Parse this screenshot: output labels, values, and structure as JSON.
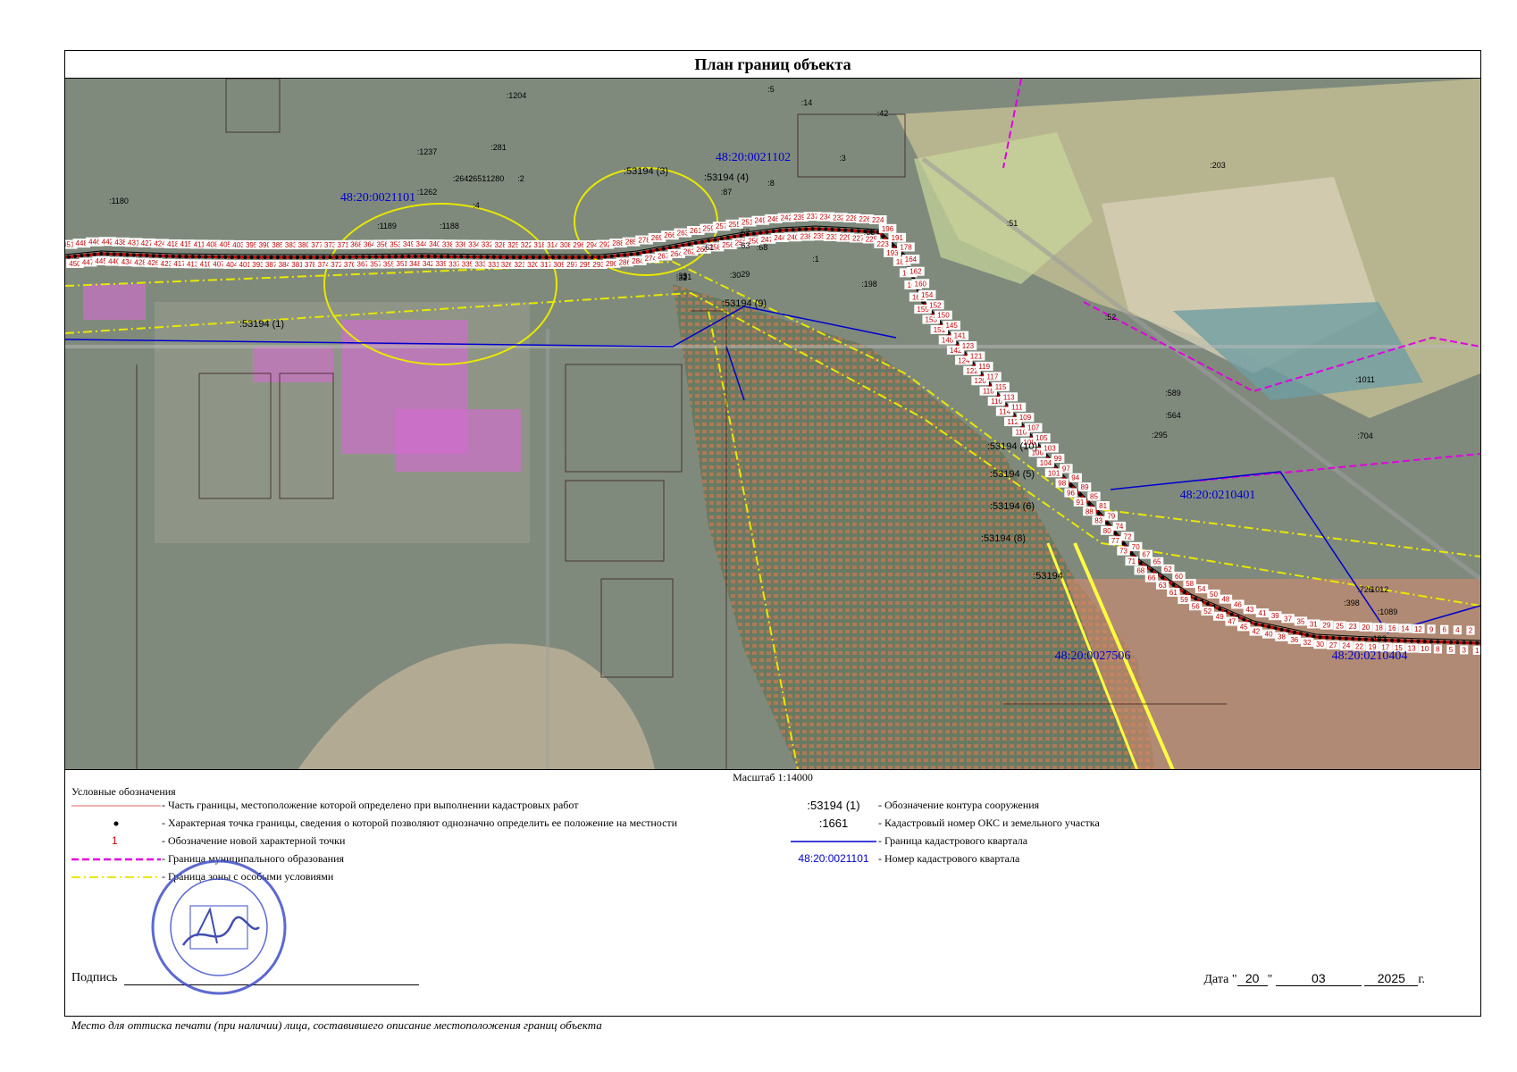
{
  "title": "План границ объекта",
  "scale_text": "Масштаб 1:14000",
  "map": {
    "quarter_labels": [
      "48:20:0021102",
      "48:20:0021101",
      "48:20:0210401",
      "48:20:0027506",
      "48:20:0210404"
    ],
    "contour_labels": [
      ":53194 (3)",
      ":53194 (4)",
      ":53194 (1)",
      ":53194 (9)",
      ":53194 (10)",
      ":53194 (5)",
      ":53194 (6)",
      ":53194 (8)",
      ":53194"
    ],
    "parcel_labels": [
      ":14",
      ":42",
      ":3",
      ":8",
      ":2",
      ":1237",
      ":1262",
      ":1280",
      ":1204",
      ":1188",
      ":1189",
      ":1180",
      ":1",
      ":88",
      ":29",
      ":30",
      ":31",
      ":32",
      ":33",
      ":198",
      ":51",
      ":52",
      ":62",
      ":63",
      ":68",
      ":87",
      ":61",
      ":704",
      ":726",
      ":1011",
      ":1012",
      ":1089",
      ":295",
      ":398",
      ":589",
      ":564",
      ":203",
      ":193",
      ":2651",
      ":2642",
      ":281",
      ":4",
      ":5"
    ],
    "point_labels": [
      "451",
      "450",
      "448",
      "447",
      "446",
      "445",
      "442",
      "440",
      "438",
      "434",
      "431",
      "428",
      "427",
      "426",
      "424",
      "423",
      "418",
      "417",
      "415",
      "413",
      "411",
      "410",
      "408",
      "407",
      "405",
      "404",
      "403",
      "401",
      "395",
      "393",
      "390",
      "387",
      "385",
      "384",
      "383",
      "381",
      "380",
      "378",
      "377",
      "374",
      "373",
      "372",
      "371",
      "370",
      "368",
      "367",
      "364",
      "357",
      "356",
      "355",
      "353",
      "351",
      "349",
      "348",
      "344",
      "342",
      "340",
      "339",
      "338",
      "337",
      "336",
      "335",
      "334",
      "333",
      "332",
      "331",
      "328",
      "326",
      "325",
      "323",
      "322",
      "320",
      "318",
      "317",
      "314",
      "309",
      "308",
      "297",
      "296",
      "295",
      "294",
      "293",
      "292",
      "290",
      "288",
      "286",
      "285",
      "284",
      "278",
      "274",
      "269",
      "267",
      "266",
      "264",
      "263",
      "262",
      "261",
      "260",
      "259",
      "258",
      "257",
      "256",
      "255",
      "252",
      "251",
      "250",
      "249",
      "247",
      "246",
      "244",
      "242",
      "240",
      "239",
      "238",
      "237",
      "235",
      "234",
      "233",
      "232",
      "229",
      "228",
      "227",
      "226",
      "225",
      "224",
      "223",
      "196",
      "193",
      "191",
      "184",
      "178",
      "166",
      "164",
      "163",
      "162",
      "161",
      "160",
      "155",
      "154",
      "153",
      "152",
      "151",
      "150",
      "148",
      "145",
      "142",
      "141",
      "124",
      "123",
      "122",
      "121",
      "120",
      "119",
      "118",
      "117",
      "116",
      "115",
      "114",
      "113",
      "112",
      "111",
      "110",
      "109",
      "108",
      "107",
      "106",
      "105",
      "104",
      "103",
      "101",
      "99",
      "98",
      "97",
      "96",
      "94",
      "91",
      "89",
      "88",
      "85",
      "83",
      "81",
      "80",
      "79",
      "77",
      "74",
      "73",
      "72",
      "71",
      "70",
      "68",
      "67",
      "66",
      "65",
      "63",
      "62",
      "61",
      "60",
      "59",
      "58",
      "56",
      "54",
      "52",
      "50",
      "49",
      "48",
      "47",
      "46",
      "45",
      "43",
      "42",
      "41",
      "40",
      "39",
      "38",
      "37",
      "36",
      "35",
      "32",
      "31",
      "30",
      "29",
      "27",
      "25",
      "24",
      "23",
      "22",
      "20",
      "19",
      "18",
      "17",
      "16",
      "15",
      "14",
      "13",
      "12",
      "10",
      "9",
      "8",
      "6",
      "5",
      "4",
      "3",
      "2",
      "1"
    ]
  },
  "legend": {
    "heading": "Условные обозначения",
    "items_left": [
      {
        "symbol_name": "red-line",
        "text": "- Часть границы, местоположение которой определено при выполнении кадастровых работ"
      },
      {
        "symbol_name": "black-dot",
        "text": "- Характерная точка границы, сведения о которой позволяют однозначно определить ее положение на местности"
      },
      {
        "symbol_name": "red-number",
        "symbol_text": "1",
        "text": "- Обозначение новой характерной точки"
      },
      {
        "symbol_name": "magenta-dashed-line",
        "text": "- Граница муниципального образования"
      },
      {
        "symbol_name": "yellow-dashdot-line",
        "text": "- Граница зоны с особыми условиями"
      }
    ],
    "items_right": [
      {
        "symbol_name": "contour-label",
        "symbol_text": ":53194 (1)",
        "text": "- Обозначение контура сооружения"
      },
      {
        "symbol_name": "parcel-label",
        "symbol_text": ":1661",
        "text": "- Кадастровый номер ОКС и земельного участка"
      },
      {
        "symbol_name": "blue-line",
        "text": "- Граница кадастрового квартала"
      },
      {
        "symbol_name": "quarter-label",
        "symbol_text": "48:20:0021101",
        "text": "- Номер кадастрового квартала"
      }
    ]
  },
  "signature_label": "Подпись",
  "date": {
    "label": "Дата",
    "day": "20",
    "month": "03",
    "year": "2025",
    "suffix": "г."
  },
  "stamp_note": "Место для оттиска печати (при наличии) лица, составившего описание местоположения границ объекта",
  "colors": {
    "boundary_red": "#c00000",
    "quarter_blue": "#0000cc",
    "municipal_magenta": "#e000e0",
    "zone_yellow": "#e8e800",
    "stamp_blue": "#4050c8"
  }
}
